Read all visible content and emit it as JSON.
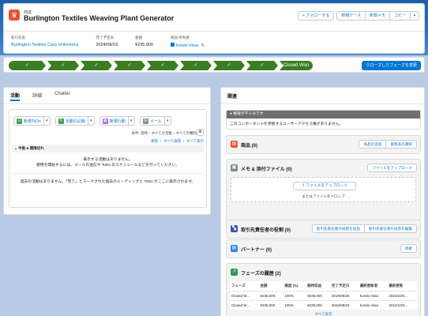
{
  "header": {
    "object_label": "商談",
    "title": "Burlington Textiles Weaving Plant Generator",
    "buttons": [
      "+ フォローする",
      "新規ケース",
      "新規メモ",
      "コピー"
    ],
    "fields": [
      {
        "label": "取引先名",
        "value": "Burlington Textiles Corp of America",
        "link": true
      },
      {
        "label": "完了予定日",
        "value": "2024/08/23",
        "link": false
      },
      {
        "label": "金額",
        "value": "¥235,000",
        "link": false
      },
      {
        "label": "商談 所有者",
        "value": "kondo misa",
        "link": true
      }
    ]
  },
  "path": {
    "steps": [
      "✓",
      "✓",
      "✓",
      "✓",
      "✓",
      "✓",
      "✓",
      "✓",
      "Closed Won"
    ],
    "button": "クローズしたフェーズを変更"
  },
  "activity": {
    "tabs": [
      "活動",
      "詳細",
      "Chatter"
    ],
    "buttons": [
      {
        "label": "新規ToDo",
        "color": "#3aa14e"
      },
      {
        "label": "活動の記録",
        "color": "#3aa14e"
      },
      {
        "label": "新規行動",
        "color": "#b15fd6"
      },
      {
        "label": "メール",
        "color": "#8a8c8e"
      }
    ],
    "filter": "条件: 常時・すべての活動・すべての種別",
    "links": "更新 ・ すべて展開 ・ すべて表示",
    "section": "今後 & 期限切れ",
    "empty_line1": "表示する活動はありません。",
    "empty_line2": "使用を開始するには、メールの送信や ToDo のスケジュールなどを行ってください。",
    "empty_past": "過去の活動はありません。「完了」とマークされた過去のミーティングと ToDo がここに表示されます。"
  },
  "related": {
    "title": "関連",
    "warning_head": "権限が不十分です",
    "warning_body": "このコンポーネントを参照するユーザーアクセス権がありません。",
    "products": {
      "name": "商品 (0)",
      "buttons": [
        "商品の追加",
        "価格表の選択"
      ],
      "color": "#e8522e"
    },
    "files": {
      "name": "メモ & 添付ファイル (0)",
      "buttons": [
        "ファイルをアップロード"
      ],
      "upload": "ファイルをアップロード",
      "drop": "またはファイルをドロップ",
      "color": "#7f8c8d"
    },
    "contact_roles": {
      "name": "取引先責任者の役割 (0)",
      "buttons": [
        "取引先責任者の役割を追加",
        "取引先責任者の役割を編集"
      ],
      "color": "#3f51b5"
    },
    "partners": {
      "name": "パートナー (0)",
      "buttons": [
        "新規"
      ],
      "color": "#2e86de"
    },
    "history": {
      "name": "フェーズの履歴 (2)",
      "color": "#2e9a5b",
      "columns": [
        "フェーズ",
        "金額",
        "確度 (%)",
        "期待収益",
        "完了予定日",
        "最終更新者",
        "最終更新"
      ],
      "rows": [
        [
          "Closed W...",
          "¥235,000",
          "100%",
          "¥235,000",
          "2019/09/25",
          "kondo misa",
          "2024/10/2..."
        ],
        [
          "Closed W...",
          "¥235,000",
          "100%",
          "¥235,000",
          "2024/08/23",
          "kondo misa",
          "2024/10/2..."
        ]
      ],
      "view_all": "すべて表示"
    }
  }
}
